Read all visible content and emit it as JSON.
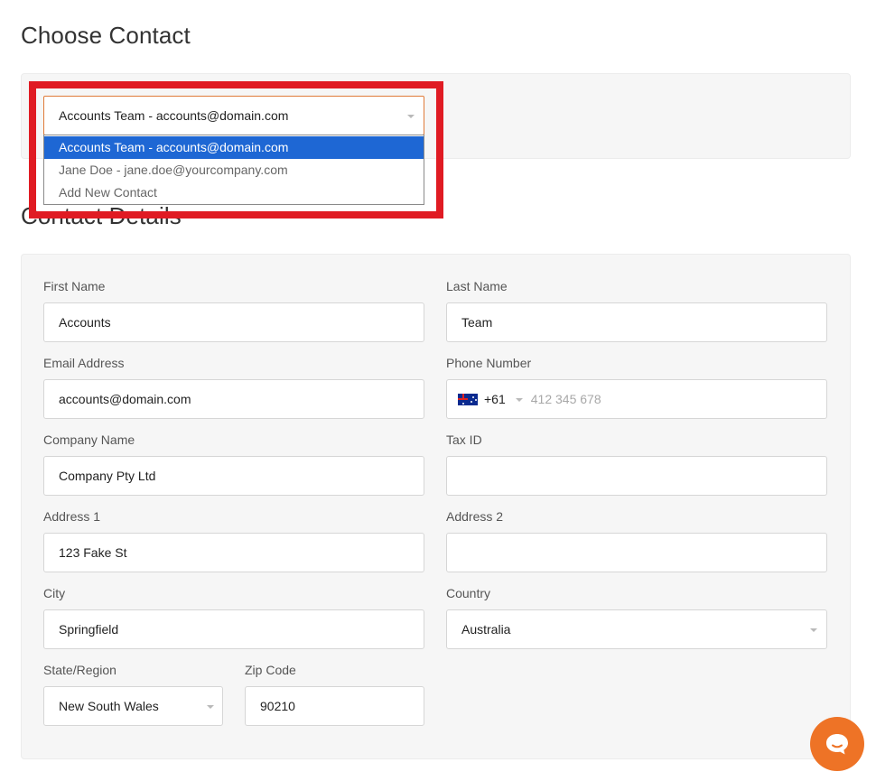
{
  "choose_contact": {
    "heading": "Choose Contact",
    "select": {
      "value": "Accounts Team - accounts@domain.com"
    },
    "options": [
      "Accounts Team - accounts@domain.com",
      "Jane Doe - jane.doe@yourcompany.com",
      "Add New Contact"
    ],
    "highlight_color": "#e01b23",
    "active_option_color": "#1e67d4"
  },
  "contact_details": {
    "heading": "Contact Details",
    "first_name": {
      "label": "First Name",
      "value": "Accounts"
    },
    "last_name": {
      "label": "Last Name",
      "value": "Team"
    },
    "email": {
      "label": "Email Address",
      "value": "accounts@domain.com"
    },
    "phone": {
      "label": "Phone Number",
      "country_code": "+61",
      "placeholder": "412 345 678",
      "flag_icon": "australia-flag-icon"
    },
    "company": {
      "label": "Company Name",
      "value": "Company Pty Ltd"
    },
    "tax_id": {
      "label": "Tax ID",
      "value": ""
    },
    "address1": {
      "label": "Address 1",
      "value": "123 Fake St"
    },
    "address2": {
      "label": "Address 2",
      "value": ""
    },
    "city": {
      "label": "City",
      "value": "Springfield"
    },
    "country": {
      "label": "Country",
      "value": "Australia"
    },
    "state": {
      "label": "State/Region",
      "value": "New South Wales"
    },
    "zip": {
      "label": "Zip Code",
      "value": "90210"
    }
  },
  "chat": {
    "icon": "chat-bubble-icon",
    "color": "#ee7326"
  }
}
